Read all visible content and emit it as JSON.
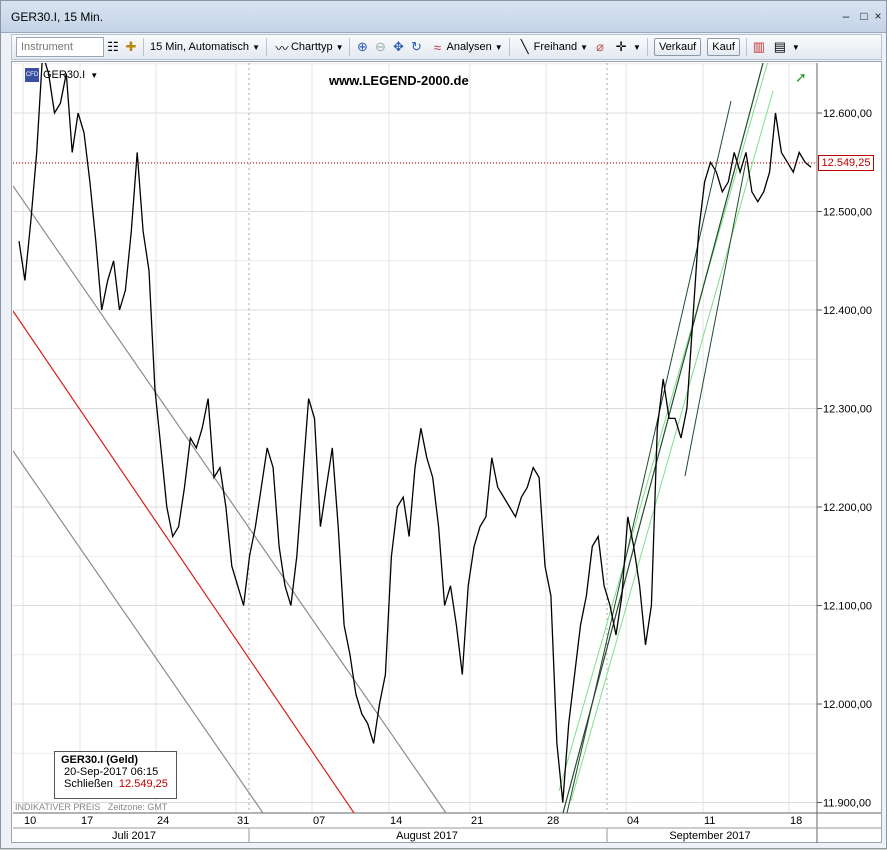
{
  "window": {
    "title": "GER30.I, 15 Min."
  },
  "toolbar": {
    "instrument_placeholder": "Instrument",
    "interval_label": "15 Min,  Automatisch",
    "charttype_label": "Charttyp",
    "analysen_label": "Analysen",
    "freihand_label": "Freihand",
    "sell_label": "Verkauf",
    "buy_label": "Kauf"
  },
  "chart_header": {
    "symbol": "GER30.I",
    "cfd_badge": "CFD",
    "watermark": "www.LEGEND-2000.de"
  },
  "legend": {
    "name": "GER30.I (Geld)",
    "datetime": "20-Sep-2017 06:15",
    "close_label": "Schließen",
    "close_value": "12.549,25"
  },
  "footer": {
    "indicative": "INDIKATIVER PREIS",
    "timezone": "Zeitzone: GMT"
  },
  "colors": {
    "price_line": "#000000",
    "red_line": "#d81e1e",
    "gray_line": "#8c8c8c",
    "dark_green": "#1f4d2b",
    "light_green": "#7fe08a",
    "current_price": "#c00000"
  },
  "chart_data": {
    "type": "line",
    "title": "",
    "ylabel": "",
    "xlabel": "",
    "ylim": [
      11890,
      12660
    ],
    "y_ticks": [
      "12.600,00",
      "12.500,00",
      "12.400,00",
      "12.300,00",
      "12.200,00",
      "12.100,00",
      "12.000,00",
      "11.900,00"
    ],
    "y_tick_values": [
      12600,
      12500,
      12400,
      12300,
      12200,
      12100,
      12000,
      11900
    ],
    "x_day_ticks": [
      "10",
      "17",
      "24",
      "31",
      "07",
      "14",
      "21",
      "28",
      "04",
      "11",
      "18"
    ],
    "x_month_labels": [
      "Juli 2017",
      "August 2017",
      "September 2017"
    ],
    "current_price": 12549.25,
    "current_price_label": "12.549,25",
    "grid": true,
    "series": [
      {
        "values": [
          12470,
          12430,
          12490,
          12560,
          12660,
          12640,
          12600,
          12610,
          12640,
          12560,
          12600,
          12580,
          12530,
          12470,
          12400,
          12430,
          12450,
          12400,
          12420,
          12480,
          12560,
          12480,
          12440,
          12320,
          12260,
          12200,
          12170,
          12180,
          12220,
          12270,
          12260,
          12280,
          12310,
          12230,
          12240,
          12200,
          12140,
          12120,
          12100,
          12150,
          12180,
          12220,
          12260,
          12240,
          12160,
          12120,
          12100,
          12150,
          12230,
          12310,
          12290,
          12180,
          12220,
          12260,
          12180,
          12080,
          12050,
          12010,
          11990,
          11980,
          11960,
          12000,
          12030,
          12150,
          12200,
          12210,
          12170,
          12240,
          12280,
          12250,
          12230,
          12180,
          12100,
          12120,
          12080,
          12030,
          12120,
          12160,
          12180,
          12190,
          12250,
          12220,
          12210,
          12200,
          12190,
          12210,
          12220,
          12240,
          12230,
          12140,
          12110,
          11960,
          11900,
          11980,
          12030,
          12080,
          12110,
          12160,
          12170,
          12120,
          12100,
          12070,
          12110,
          12190,
          12160,
          12120,
          12060,
          12100,
          12280,
          12330,
          12290,
          12290,
          12270,
          12300,
          12390,
          12480,
          12530,
          12550,
          12540,
          12520,
          12530,
          12560,
          12540,
          12560,
          12520,
          12510,
          12520,
          12540,
          12600,
          12560,
          12550,
          12540,
          12560,
          12550,
          12545
        ]
      }
    ],
    "trendlines": "descending gray channel, descending red line, rising green channel"
  }
}
